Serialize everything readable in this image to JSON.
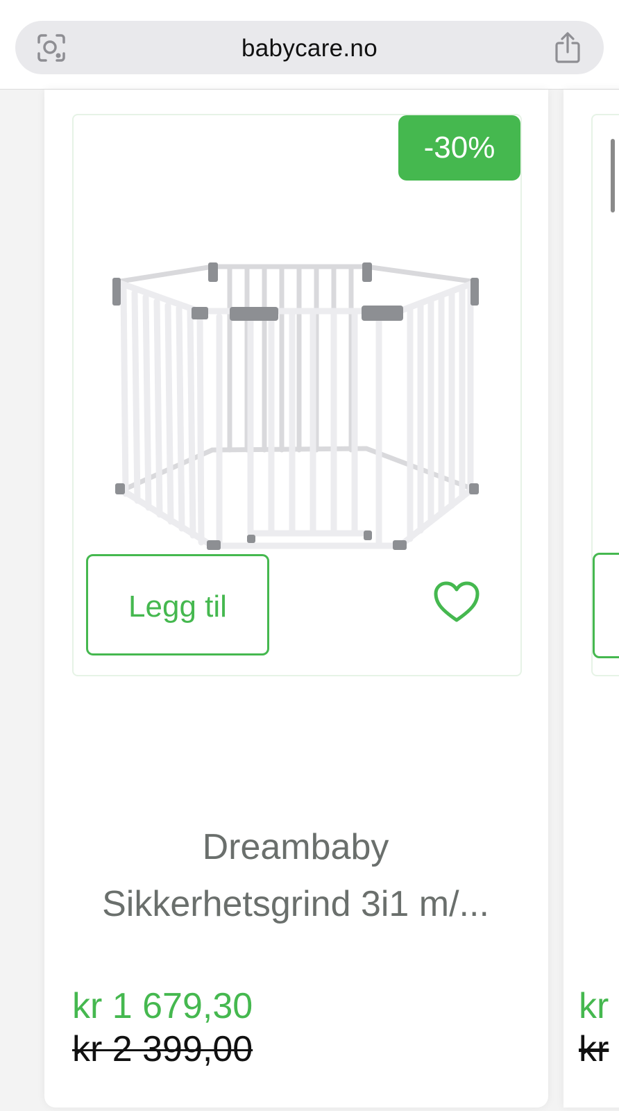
{
  "browser": {
    "url": "babycare.no",
    "lens_icon": "visual-lookup-icon",
    "share_icon": "share-icon"
  },
  "product": {
    "discount_badge": "-30%",
    "add_button": "Legg til",
    "favorite_icon": "heart-icon",
    "title_line1": "Dreambaby",
    "title_line2": "Sikkerhetsgrind 3i1 m/...",
    "price_current": "kr 1 679,30",
    "price_original": "kr 2 399,00"
  },
  "next_product": {
    "price_current": "kr",
    "price_original": "kr"
  },
  "colors": {
    "accent_green": "#45b84f",
    "title_gray": "#6a6f6c"
  }
}
